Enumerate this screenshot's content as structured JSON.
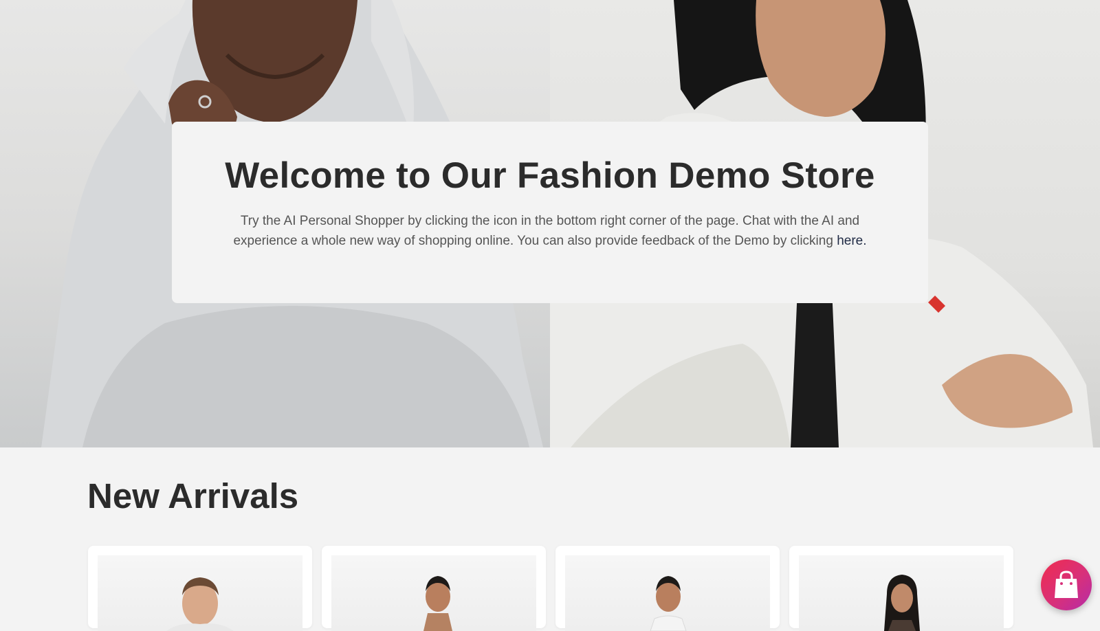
{
  "hero": {
    "card": {
      "title": "Welcome to Our Fashion Demo Store",
      "text_before_link": "Try the AI Personal Shopper by clicking the icon in the bottom right corner of the page. Chat with the AI and experience a whole new way of shopping online. You can also provide feedback of the Demo by clicking ",
      "link_label": "here."
    }
  },
  "new_arrivals": {
    "title": "New Arrivals",
    "products": [
      {
        "image": "man-in-white-tshirt-photo"
      },
      {
        "image": "woman-in-top-photo"
      },
      {
        "image": "woman-in-white-tee-photo"
      },
      {
        "image": "woman-in-dark-top-photo"
      }
    ]
  },
  "shopper_button": {
    "icon": "shopping-bag-icon",
    "colors": [
      "#ef2d4e",
      "#b52ca8"
    ]
  },
  "colors": {
    "background": "#f3f3f3",
    "heading": "#2b2b2b",
    "body_text": "#555555",
    "link": "#1f2a44"
  }
}
